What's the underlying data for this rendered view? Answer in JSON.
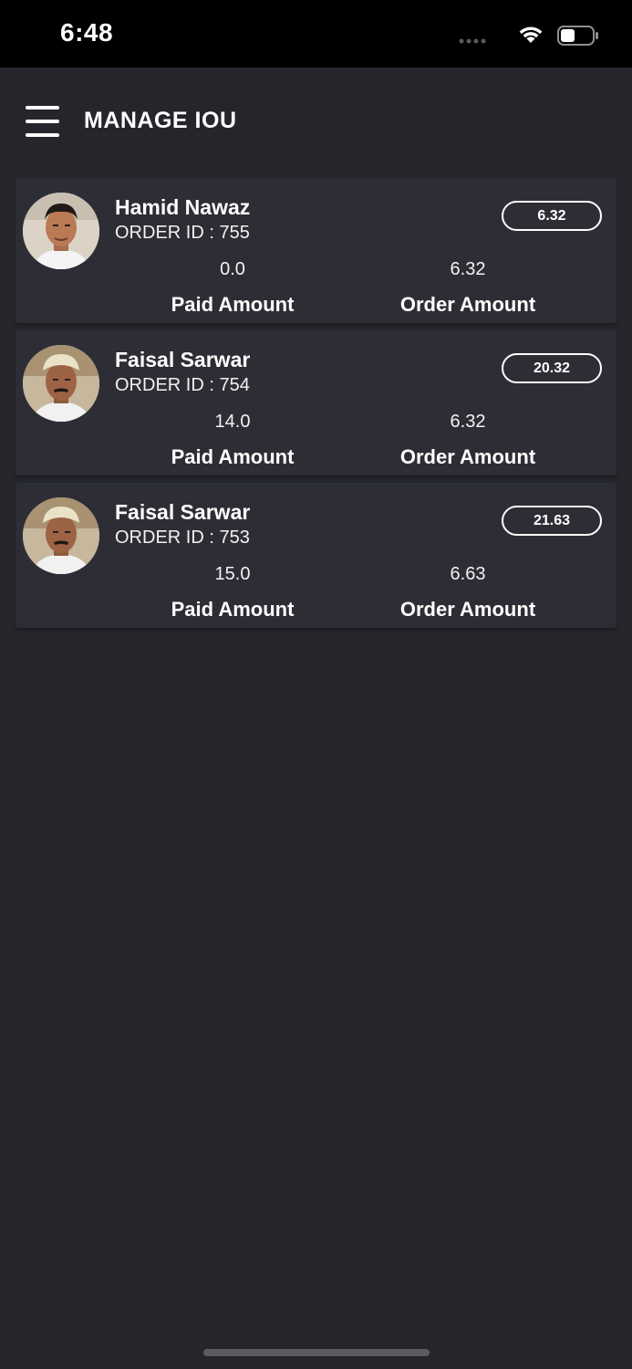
{
  "status_bar": {
    "time": "6:48"
  },
  "header": {
    "title": "MANAGE IOU"
  },
  "orders": [
    {
      "name": "Hamid Nawaz",
      "order_id": "ORDER ID : 755",
      "badge": "6.32",
      "paid_value": "0.0",
      "order_value": "6.32",
      "paid_label": "Paid Amount",
      "order_label": "Order Amount"
    },
    {
      "name": "Faisal Sarwar",
      "order_id": "ORDER ID : 754",
      "badge": "20.32",
      "paid_value": "14.0",
      "order_value": "6.32",
      "paid_label": "Paid Amount",
      "order_label": "Order Amount"
    },
    {
      "name": "Faisal Sarwar",
      "order_id": "ORDER ID : 753",
      "badge": "21.63",
      "paid_value": "15.0",
      "order_value": "6.63",
      "paid_label": "Paid Amount",
      "order_label": "Order Amount"
    }
  ],
  "colors": {
    "background": "#25262c",
    "card": "#2d2e35",
    "status_bar": "#000000",
    "text": "#ffffff"
  }
}
